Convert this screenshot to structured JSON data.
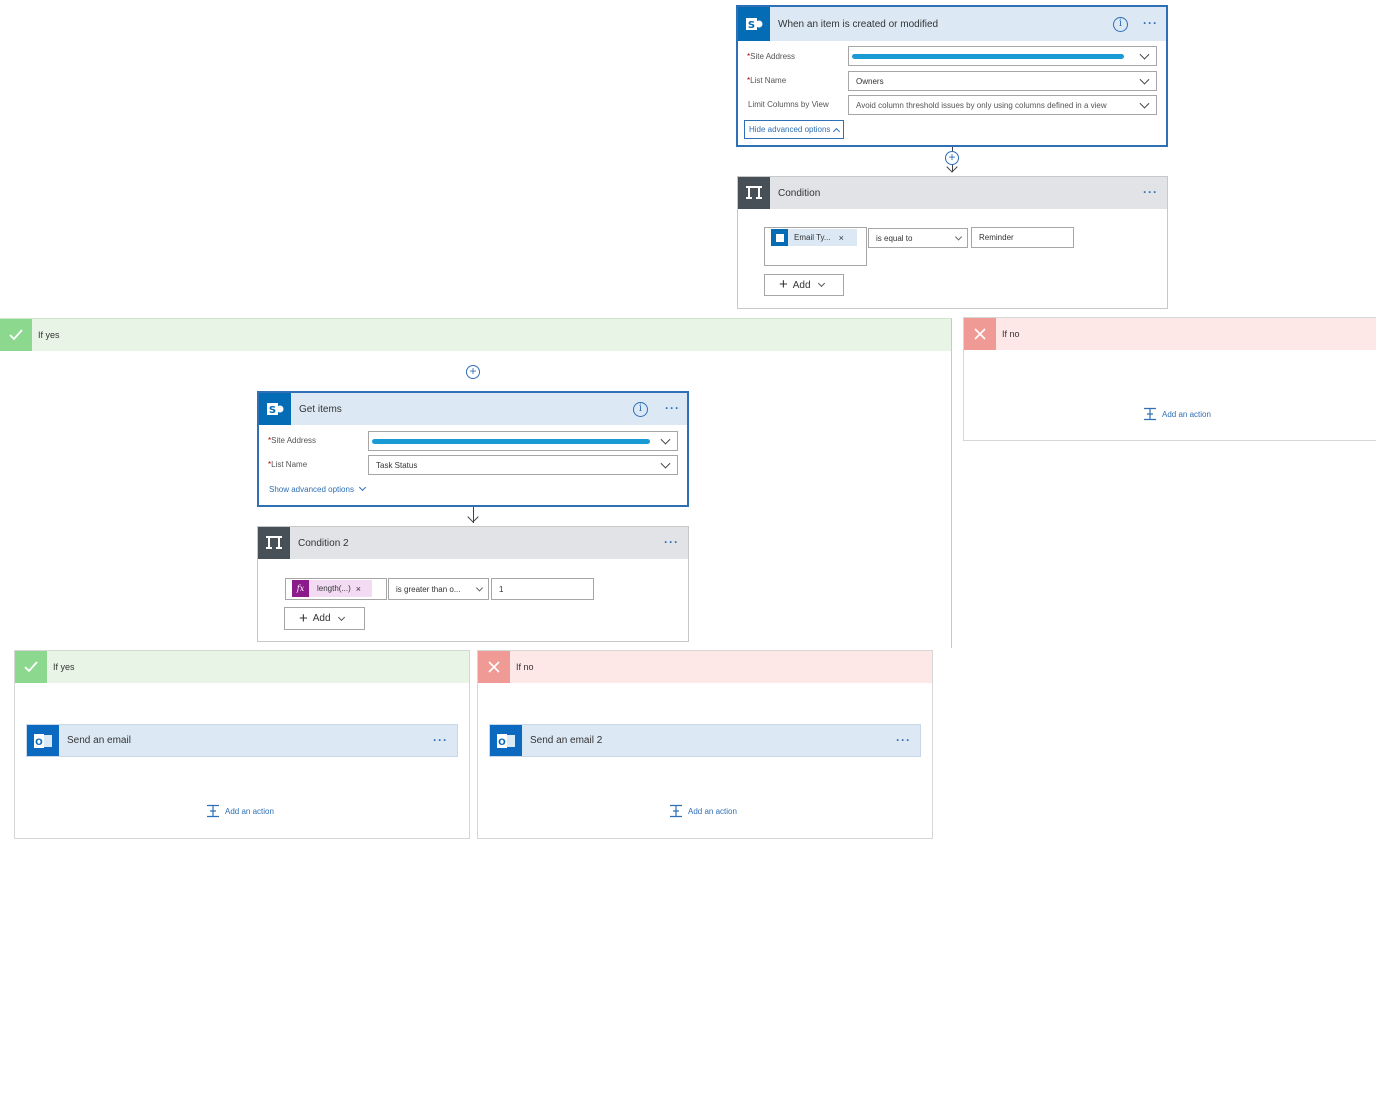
{
  "trigger": {
    "title": "When an item is created or modified",
    "site_address_label": "Site Address",
    "list_name_label": "List Name",
    "list_name_value": "Owners",
    "limit_columns_label": "Limit Columns by View",
    "limit_columns_value": "Avoid column threshold issues by only using columns defined in a view",
    "advanced_link": "Hide advanced options"
  },
  "condition1": {
    "title": "Condition",
    "token_label": "Email Ty...",
    "token_remove": "×",
    "operator": "is equal to",
    "value": "Reminder",
    "add_label": "Add"
  },
  "branch_yes": {
    "title": "If yes"
  },
  "branch_no": {
    "title": "If no",
    "add_action": "Add an action"
  },
  "get_items": {
    "title": "Get items",
    "site_address_label": "Site Address",
    "list_name_label": "List Name",
    "list_name_value": "Task Status",
    "advanced_link": "Show advanced options"
  },
  "condition2": {
    "title": "Condition 2",
    "token_label": "length(...)",
    "token_remove": "×",
    "func_symbol": "fx",
    "operator": "is greater than o...",
    "value": "1",
    "add_label": "Add"
  },
  "inner_yes": {
    "title": "If yes",
    "action_title": "Send an email",
    "add_action": "Add an action"
  },
  "inner_no": {
    "title": "If no",
    "action_title": "Send an email 2",
    "add_action": "Add an action"
  },
  "common": {
    "required_mark": "*",
    "ellipsis": "···",
    "info_glyph": "i",
    "plus_glyph": "+"
  },
  "colors": {
    "accent": "#2f6fb5",
    "sharepoint": "#036cb5",
    "condition_tile": "#474f57",
    "yes_tile": "#8cd88f",
    "no_tile": "#f09a95",
    "function_token": "#8b1a8b"
  }
}
